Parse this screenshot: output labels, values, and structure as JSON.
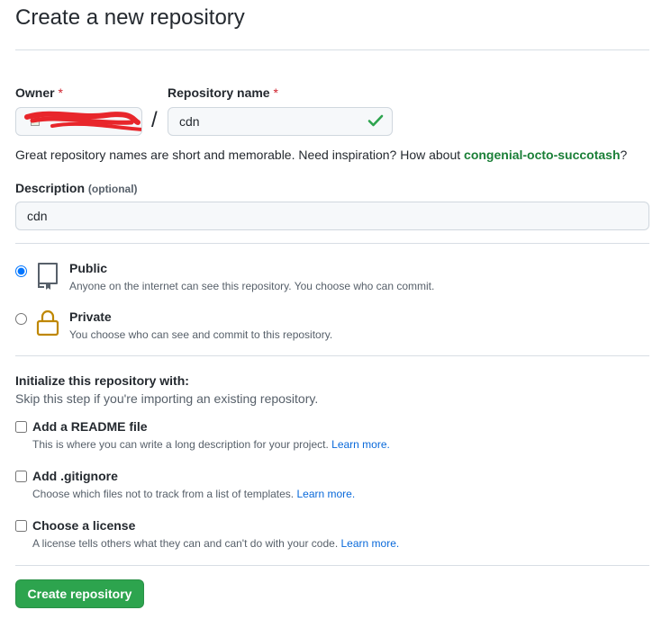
{
  "page": {
    "title": "Create a new repository"
  },
  "owner": {
    "label": "Owner",
    "required_marker": "*"
  },
  "separator": "/",
  "repository_name": {
    "label": "Repository name",
    "required_marker": "*",
    "value": "cdn",
    "status_icon": "check-icon"
  },
  "name_hint": {
    "text": "Great repository names are short and memorable. Need inspiration? How about ",
    "suggestion": "congenial-octo-succotash",
    "suffix": "?"
  },
  "description": {
    "label": "Description",
    "optional": "(optional)",
    "value": "cdn"
  },
  "visibility": {
    "selected": "public",
    "options": [
      {
        "id": "public",
        "label": "Public",
        "description": "Anyone on the internet can see this repository. You choose who can commit.",
        "icon": "repo-icon"
      },
      {
        "id": "private",
        "label": "Private",
        "description": "You choose who can see and commit to this repository.",
        "icon": "lock-icon"
      }
    ]
  },
  "initialize": {
    "title": "Initialize this repository with:",
    "subtitle": "Skip this step if you're importing an existing repository.",
    "options": [
      {
        "label": "Add a README file",
        "description": "This is where you can write a long description for your project. ",
        "link": "Learn more.",
        "checked": false
      },
      {
        "label": "Add .gitignore",
        "description": "Choose which files not to track from a list of templates. ",
        "link": "Learn more.",
        "checked": false
      },
      {
        "label": "Choose a license",
        "description": "A license tells others what they can and can't do with your code. ",
        "link": "Learn more.",
        "checked": false
      }
    ]
  },
  "submit": {
    "label": "Create repository"
  },
  "colors": {
    "primary_button": "#2da44e",
    "link": "#0969da",
    "suggestion": "#1a7f37",
    "required": "#cf222e",
    "redaction": "#e8262b"
  }
}
